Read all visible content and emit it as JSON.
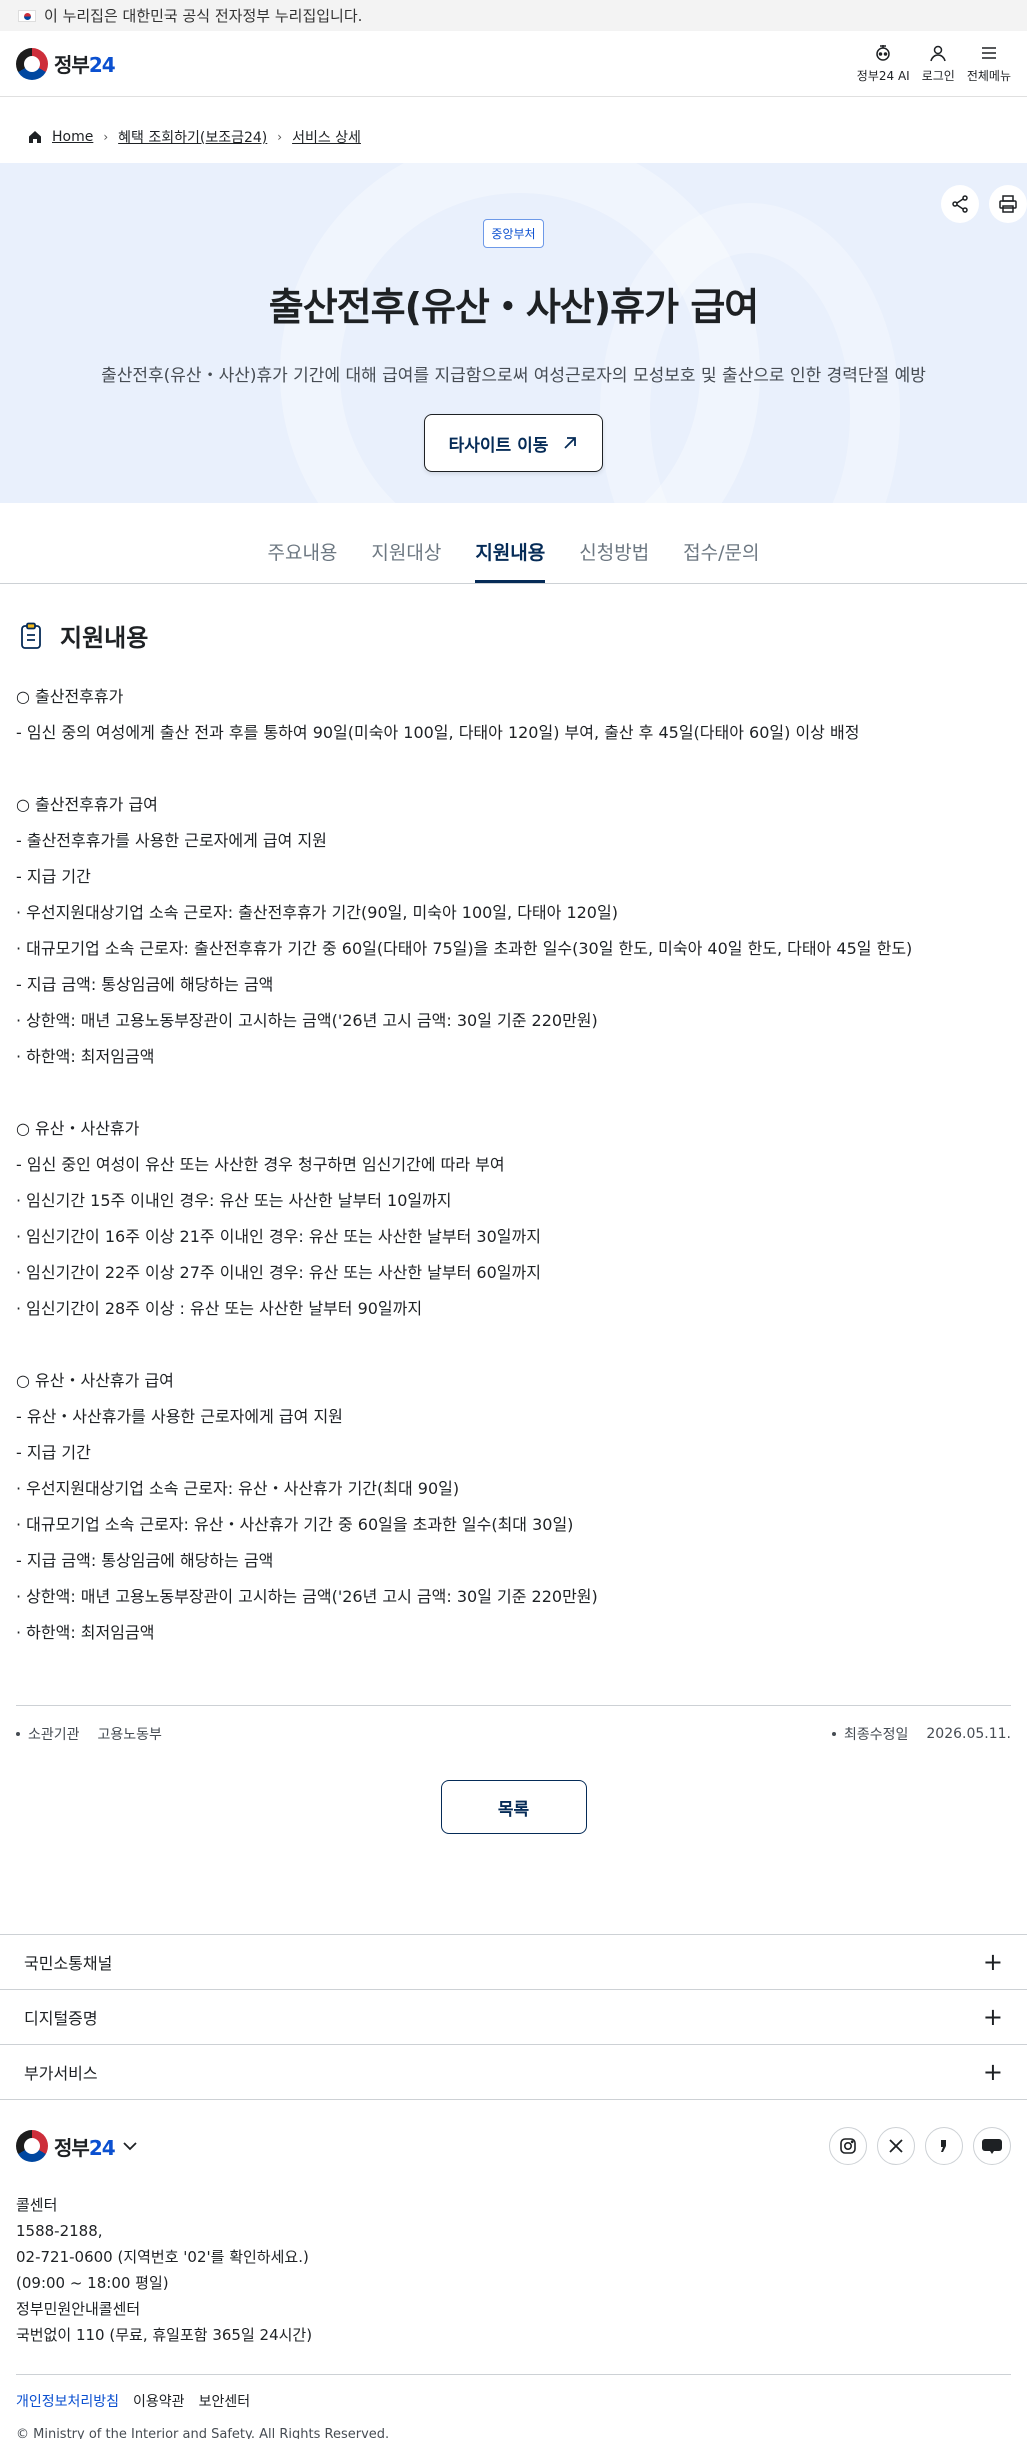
{
  "gov_banner": {
    "text": "이 누리집은 대한민국 공식 전자정부 누리집입니다."
  },
  "header": {
    "logo_text": "정부",
    "logo_num": "24",
    "actions": [
      {
        "label": "정부24 AI",
        "icon": "ai-bot-icon"
      },
      {
        "label": "로그인",
        "icon": "user-icon"
      },
      {
        "label": "전체메뉴",
        "icon": "menu-icon"
      }
    ]
  },
  "breadcrumb": {
    "home": "Home",
    "level1": "혜택 조회하기(보조금24)",
    "level2": "서비스 상세"
  },
  "hero": {
    "badge": "중앙부처",
    "title": "출산전후(유산・사산)휴가 급여",
    "description": "출산전후(유산・사산)휴가 기간에 대해 급여를 지급함으로써 여성근로자의 모성보호 및 출산으로 인한 경력단절 예방",
    "site_button": "타사이트 이동",
    "share_icon": "share-icon",
    "print_icon": "print-icon"
  },
  "tabs": [
    {
      "label": "주요내용",
      "active": false
    },
    {
      "label": "지원대상",
      "active": false
    },
    {
      "label": "지원내용",
      "active": true
    },
    {
      "label": "신청방법",
      "active": false
    },
    {
      "label": "접수/문의",
      "active": false
    }
  ],
  "section": {
    "title": "지원내용",
    "lines": [
      "○ 출산전후휴가",
      "- 임신 중의 여성에게 출산 전과 후를 통하여 90일(미숙아 100일, 다태아 120일) 부여, 출산 후 45일(다태아 60일) 이상 배정",
      "",
      "○ 출산전후휴가 급여",
      "- 출산전후휴가를 사용한 근로자에게 급여 지원",
      "- 지급 기간",
      "· 우선지원대상기업 소속 근로자: 출산전후휴가 기간(90일, 미숙아 100일, 다태아 120일)",
      "· 대규모기업 소속 근로자: 출산전후휴가 기간 중 60일(다태아 75일)을 초과한 일수(30일 한도, 미숙아 40일 한도, 다태아 45일 한도)",
      "- 지급 금액: 통상임금에 해당하는 금액",
      "· 상한액: 매년 고용노동부장관이 고시하는 금액('26년 고시 금액: 30일 기준 220만원)",
      "· 하한액: 최저임금액",
      "",
      "○ 유산・사산휴가",
      "- 임신 중인 여성이 유산 또는 사산한 경우 청구하면 임신기간에 따라 부여",
      "· 임신기간 15주 이내인 경우: 유산 또는 사산한 날부터 10일까지",
      "· 임신기간이 16주 이상 21주 이내인 경우: 유산 또는 사산한 날부터 30일까지",
      "· 임신기간이 22주 이상 27주 이내인 경우: 유산 또는 사산한 날부터 60일까지",
      "· 임신기간이 28주 이상 : 유산 또는 사산한 날부터 90일까지",
      "",
      "○ 유산・사산휴가 급여",
      "- 유산・사산휴가를 사용한 근로자에게 급여 지원",
      "- 지급 기간",
      "· 우선지원대상기업 소속 근로자: 유산・사산휴가 기간(최대 90일)",
      "· 대규모기업 소속 근로자: 유산・사산휴가 기간 중 60일을 초과한 일수(최대 30일)",
      "- 지급 금액: 통상임금에 해당하는 금액",
      "· 상한액: 매년 고용노동부장관이 고시하는 금액('26년 고시 금액: 30일 기준 220만원)",
      "· 하한액: 최저임금액"
    ]
  },
  "meta": {
    "agency_label": "소관기관",
    "agency_value": "고용노동부",
    "updated_label": "최종수정일",
    "updated_value": "2026.05.11."
  },
  "list_button": "목록",
  "accordions": [
    "국민소통채널",
    "디지털증명",
    "부가서비스"
  ],
  "footer": {
    "logo_text": "정부",
    "logo_num": "24",
    "socials": [
      "instagram-icon",
      "x-icon",
      "naver-post-icon",
      "blog-icon"
    ],
    "contact": {
      "title": "콜센터",
      "line1": "1588-2188,",
      "line2": "02-721-0600 (지역번호 '02'를 확인하세요.)",
      "line3": "(09:00 ~ 18:00 평일)",
      "title2": "정부민원안내콜센터",
      "line4": "국번없이 110 (무료, 휴일포함 365일 24시간)"
    },
    "links": [
      "개인정보처리방침",
      "이용약관",
      "보안센터"
    ],
    "copyright": "© Ministry of the Interior and Safety. All Rights Reserved."
  }
}
